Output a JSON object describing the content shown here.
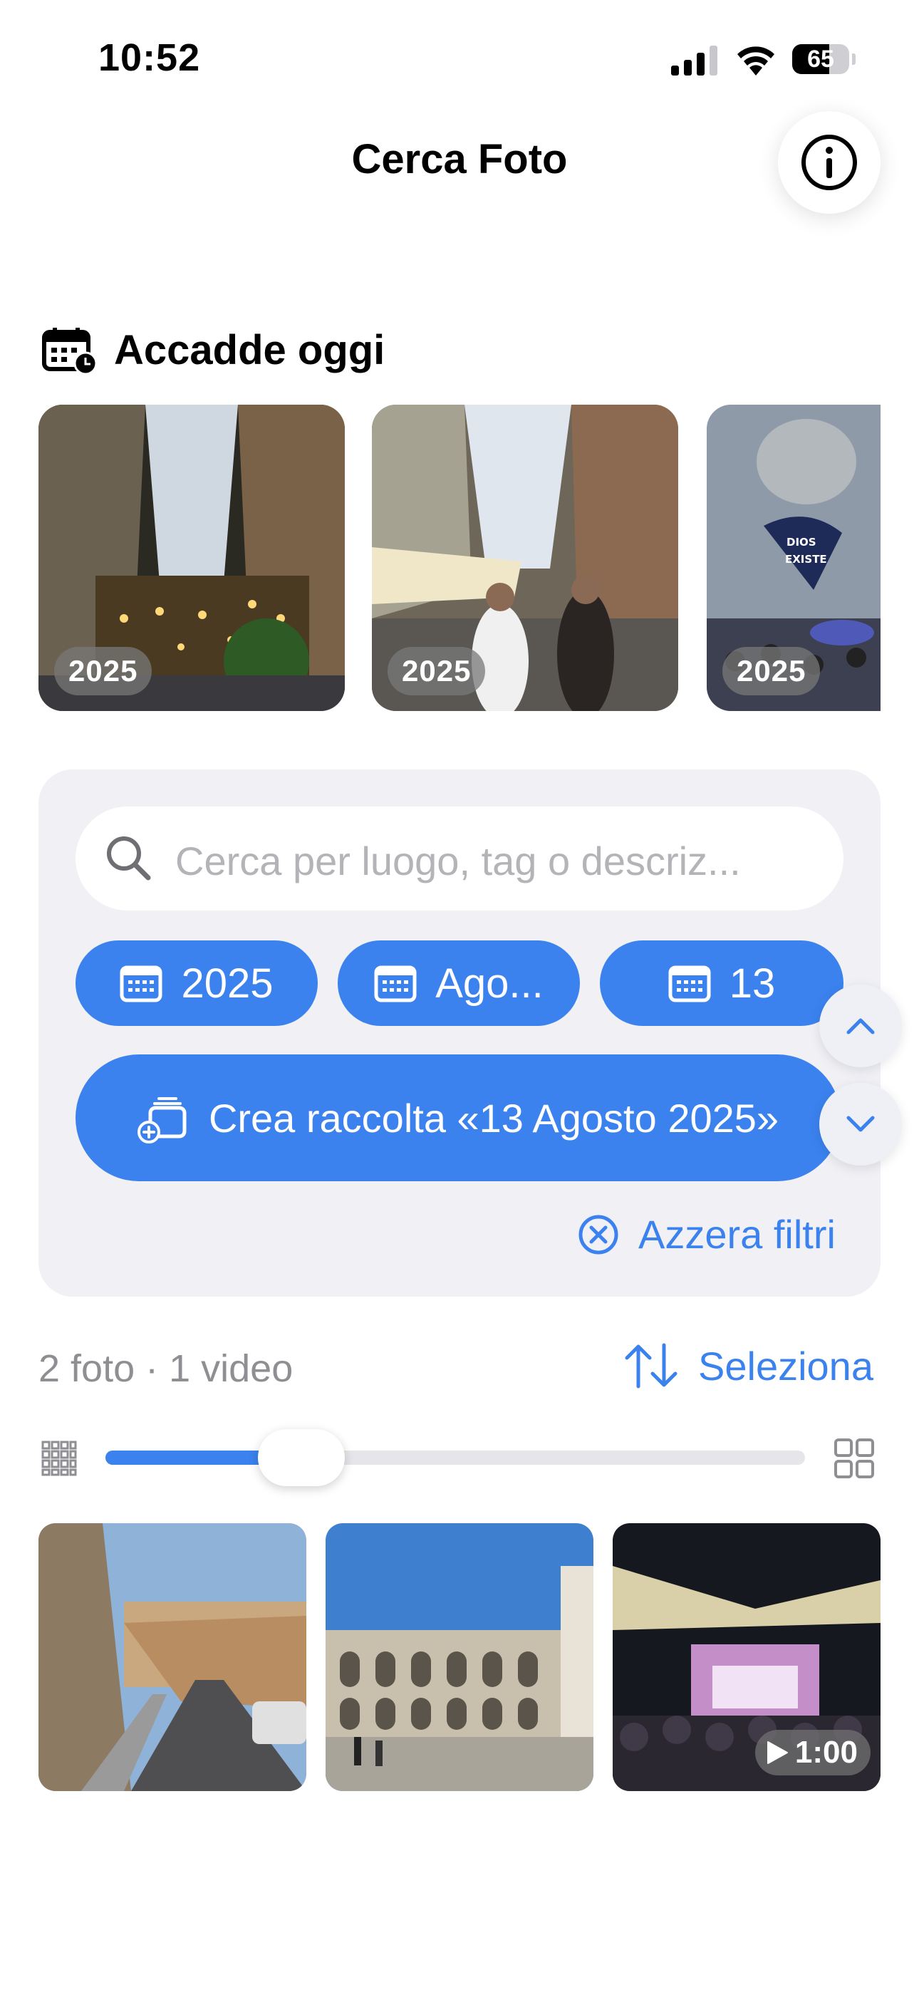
{
  "status_bar": {
    "time": "10:52",
    "battery": "65",
    "battery_level": 0.65,
    "icons": [
      "cellular-signal-icon",
      "wifi-icon",
      "battery-icon"
    ]
  },
  "header": {
    "title": "Cerca Foto",
    "info_icon": "info-circle-icon"
  },
  "on_this_day": {
    "title": "Accadde oggi",
    "icon": "calendar-clock-icon",
    "items": [
      {
        "year": "2025"
      },
      {
        "year": "2025"
      },
      {
        "year": "2025"
      }
    ]
  },
  "search": {
    "placeholder": "Cerca per luogo, tag o descriz..."
  },
  "filters": {
    "chips": [
      {
        "label": "2025",
        "icon": "calendar-icon"
      },
      {
        "label": "Ago...",
        "icon": "calendar-icon"
      },
      {
        "label": "13",
        "icon": "calendar-icon"
      }
    ],
    "create_collection": "Crea raccolta «13 Agosto 2025»",
    "reset": "Azzera filtri",
    "scroll_up_icon": "chevron-up-icon",
    "scroll_down_icon": "chevron-down-icon"
  },
  "results": {
    "count": "2 foto · 1 video",
    "select": "Seleziona",
    "sort_icon": "sort-arrows-icon",
    "grid_size_level": 0.28,
    "items": [
      {
        "type": "photo"
      },
      {
        "type": "photo"
      },
      {
        "type": "video",
        "duration": "1:00"
      }
    ]
  },
  "colors": {
    "accent": "#3b82ee",
    "panel": "#f0f0f5",
    "placeholder": "#b3b3b8",
    "secondary_text": "#8e8e93"
  }
}
